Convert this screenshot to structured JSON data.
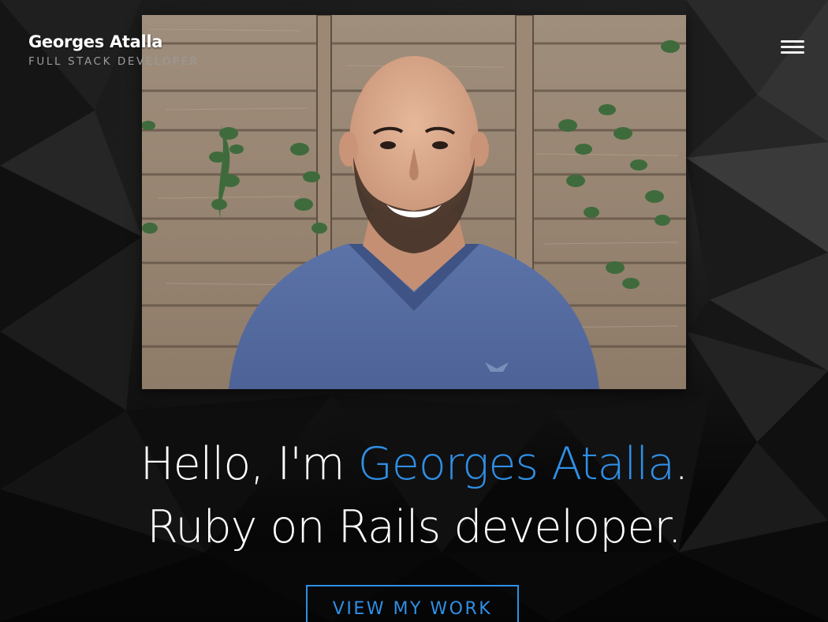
{
  "brand": {
    "name": "Georges Atalla",
    "subtitle": "FULL STACK DEVELOPER"
  },
  "nav": {
    "menu_icon": "hamburger-menu-icon"
  },
  "hero": {
    "photo_icon": "profile-photo",
    "line1_prefix": "Hello, I'm ",
    "line1_name": "Georges Atalla",
    "line1_suffix": ".",
    "line2": "Ruby on Rails developer.",
    "cta_label": "VIEW MY WORK"
  },
  "colors": {
    "accent": "#2f8fe6",
    "background": "#0c0c0c",
    "text": "#ffffff",
    "subtitle": "#9a9a9a"
  }
}
